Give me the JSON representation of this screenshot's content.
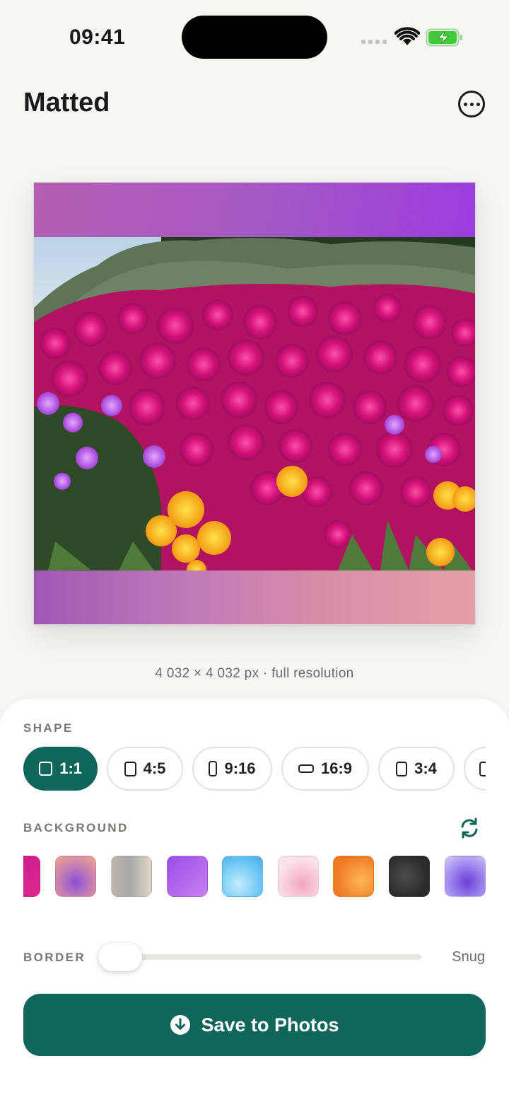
{
  "status": {
    "time": "09:41"
  },
  "header": {
    "title": "Matted"
  },
  "preview": {
    "resolution": "4 032 × 4 032 px · full resolution"
  },
  "shape": {
    "label": "SHAPE",
    "options": [
      {
        "label": "1:1",
        "active": true
      },
      {
        "label": "4:5",
        "active": false
      },
      {
        "label": "9:16",
        "active": false
      },
      {
        "label": "16:9",
        "active": false
      },
      {
        "label": "3:4",
        "active": false
      }
    ]
  },
  "background": {
    "label": "BACKGROUND",
    "swatches": [
      {
        "name": "magenta",
        "colors": [
          "#c21a8a",
          "#e02890"
        ]
      },
      {
        "name": "peach-violet",
        "colors": [
          "#f3a88a",
          "#8a4fd6"
        ],
        "selected": true
      },
      {
        "name": "taupe",
        "colors": [
          "#bdb6ab",
          "#e0d8c8"
        ]
      },
      {
        "name": "purple",
        "colors": [
          "#9b4de6",
          "#c97ff3"
        ]
      },
      {
        "name": "sky-blue",
        "colors": [
          "#6cc7f5",
          "#c5ecff"
        ]
      },
      {
        "name": "pink",
        "colors": [
          "#f3c7d6",
          "#fbe3ea"
        ]
      },
      {
        "name": "orange",
        "colors": [
          "#f07a24",
          "#ffb558"
        ]
      },
      {
        "name": "charcoal",
        "colors": [
          "#2b2b2b",
          "#4d4d4d"
        ]
      },
      {
        "name": "lavender",
        "colors": [
          "#a28cf0",
          "#6a3fd6"
        ]
      }
    ]
  },
  "border": {
    "label": "BORDER",
    "value_label": "Snug",
    "level": 0.0
  },
  "actions": {
    "save_label": "Save to Photos"
  },
  "colors": {
    "accent": "#11665c",
    "background": "#f7f6f3"
  }
}
